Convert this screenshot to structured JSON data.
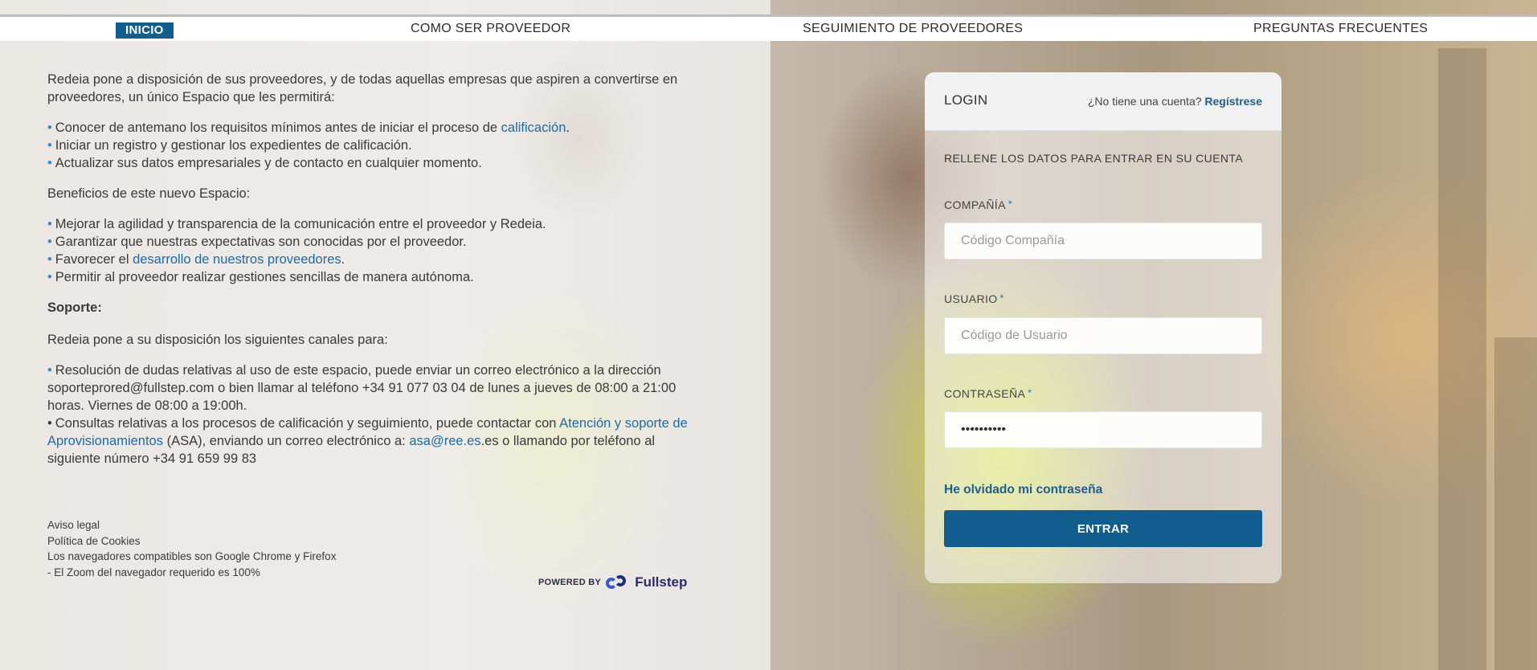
{
  "nav": {
    "items": [
      {
        "label": "INICIO"
      },
      {
        "label": "COMO SER PROVEEDOR"
      },
      {
        "label": "SEGUIMIENTO DE PROVEEDORES"
      },
      {
        "label": "PREGUNTAS FRECUENTES"
      }
    ]
  },
  "intro": {
    "paragraph": "Redeia pone a disposición de sus proveedores, y de todas aquellas empresas que aspiren a convertirse en proveedores, un único Espacio que les permitirá:",
    "items": [
      {
        "text": "Conocer de antemano los requisitos mínimos antes de iniciar el proceso de ",
        "link": "calificación",
        "after": "."
      },
      {
        "text": "Iniciar un registro y gestionar los expedientes de calificación."
      },
      {
        "text": "Actualizar sus datos empresariales y de contacto en cualquier momento."
      }
    ]
  },
  "benefits": {
    "heading": "Beneficios de este nuevo Espacio:",
    "items": [
      {
        "text": "Mejorar la agilidad y transparencia de la comunicación entre el proveedor y Redeia."
      },
      {
        "text": "Garantizar que nuestras expectativas son conocidas por el proveedor."
      },
      {
        "text": "Favorecer el ",
        "link": "desarrollo de nuestros proveedores",
        "after": "."
      },
      {
        "text": "Permitir al proveedor realizar gestiones sencillas de manera autónoma."
      }
    ]
  },
  "support": {
    "heading": "Soporte:",
    "paragraph": "Redeia pone a su disposición los siguientes canales para:",
    "item1": "Resolución de dudas relativas al uso de este espacio, puede enviar un correo electrónico a la dirección soporteprored@fullstep.com o bien llamar al teléfono +34 91 077 03 04 de lunes a jueves de 08:00 a 21:00 horas. Viernes de 08:00 a 19:00h.",
    "item2_text": "Consultas relativas a los procesos de calificación y seguimiento, puede contactar con ",
    "item2_link": "Atención y soporte de Aprovisionamientos",
    "item2_mid": " (ASA), enviando un correo electrónico a: ",
    "item2_email": "asa@ree.es",
    "item2_end": ".es o llamando por teléfono al siguiente número +34 91 659 99 83"
  },
  "footer": {
    "legal": "Aviso legal",
    "cookies": "Política de Cookies",
    "browsers": "Los navegadores compatibles son Google Chrome y Firefox",
    "zoom": "- El Zoom del navegador requerido es 100%",
    "powered_by": "POWERED BY",
    "brand": "Fullstep"
  },
  "login": {
    "title": "LOGIN",
    "no_account": "¿No tiene una cuenta?",
    "register": "Regístrese",
    "subtitle": "RELLENE LOS DATOS PARA ENTRAR EN SU CUENTA",
    "company_label": "COMPAÑÍA",
    "company_placeholder": "Código Compañía",
    "user_label": "USUARIO",
    "user_placeholder": "Código de Usuario",
    "password_label": "CONTRASEÑA",
    "password_value": "••••••••••",
    "required_mark": "*",
    "forgot": "He olvidado mi contraseña",
    "submit": "ENTRAR"
  },
  "colors": {
    "primary": "#115e8e",
    "link": "#1f6aa5",
    "bullet": "#3a86c8"
  }
}
